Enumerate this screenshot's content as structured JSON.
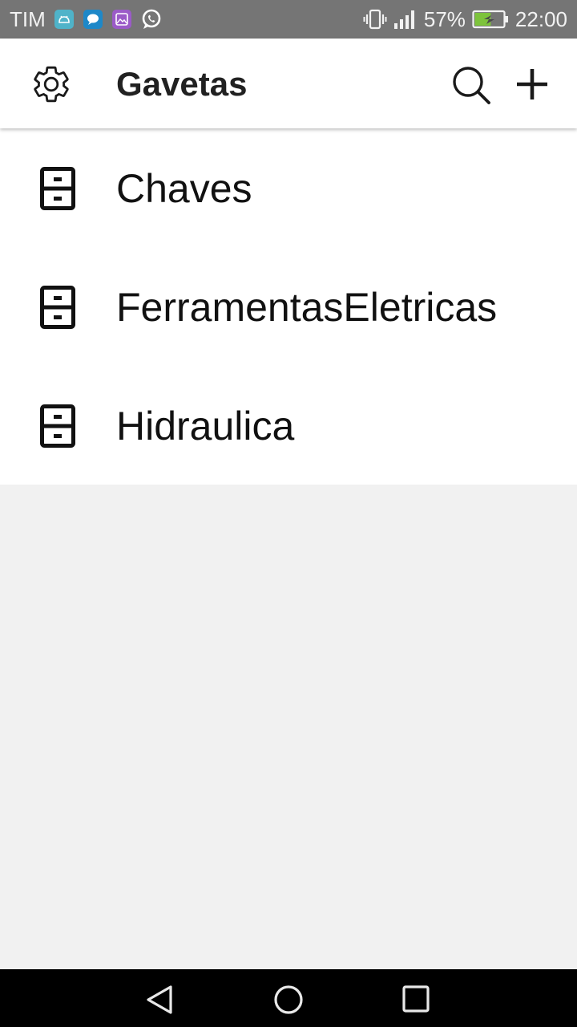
{
  "status_bar": {
    "carrier": "TIM",
    "battery_percent": "57%",
    "battery_level": 0.57,
    "time": "22:00",
    "notification_icons": [
      "android-icon",
      "chat-icon",
      "gallery-icon",
      "whatsapp-icon"
    ]
  },
  "app_bar": {
    "title": "Gavetas",
    "icons": [
      "gear-icon",
      "search-icon",
      "plus-icon"
    ]
  },
  "drawers": [
    {
      "label": "Chaves",
      "icon": "drawer-cabinet-icon"
    },
    {
      "label": "FerramentasEletricas",
      "icon": "drawer-cabinet-icon"
    },
    {
      "label": "Hidraulica",
      "icon": "drawer-cabinet-icon"
    }
  ],
  "nav_bar": {
    "icons": [
      "back-icon",
      "home-icon",
      "recents-icon"
    ]
  },
  "colors": {
    "status_bar": "#757575",
    "app_bar": "#ffffff",
    "background": "#f1f1f1",
    "nav_bar": "#000000",
    "battery": "#7dc33b"
  }
}
